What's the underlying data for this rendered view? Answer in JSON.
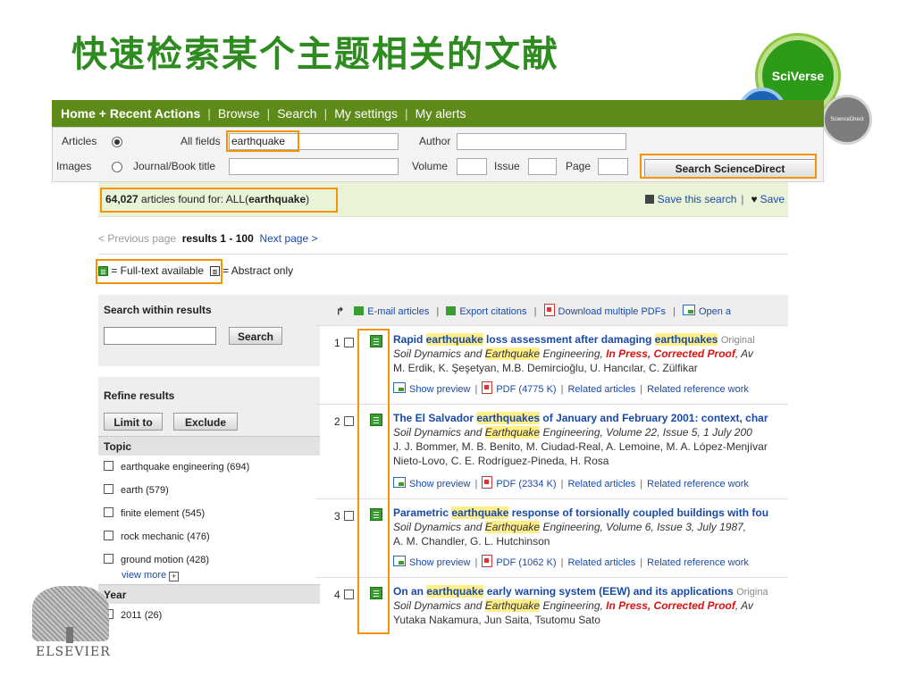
{
  "slide": {
    "title": "快速检索某个主题相关的文献"
  },
  "logos": {
    "sciverse": "SciVerse",
    "sciencedirect": "ScienceDirect",
    "publisher": "ELSEVIER"
  },
  "nav": {
    "home": "Home + Recent Actions",
    "items": [
      "Browse",
      "Search",
      "My settings",
      "My alerts"
    ]
  },
  "form": {
    "articles_label": "Articles",
    "images_label": "Images",
    "allfields_label": "All fields",
    "allfields_value": "earthquake",
    "journal_label": "Journal/Book title",
    "author_label": "Author",
    "volume_label": "Volume",
    "issue_label": "Issue",
    "page_label": "Page",
    "submit": "Search ScienceDirect"
  },
  "results_bar": {
    "count": "64,027",
    "found_text": " articles found for: ALL(",
    "query": "earthquake",
    "close": ")",
    "save_search": "Save this search",
    "save_more": "Save"
  },
  "pager": {
    "prev": "< Previous page",
    "current": "results 1 - 100",
    "next": "Next page >"
  },
  "legend": {
    "fulltext": "= Full-text available",
    "abstract": "= Abstract only"
  },
  "sidebar": {
    "search_within": "Search within results",
    "search_button": "Search",
    "refine": "Refine results",
    "limit": "Limit to",
    "exclude": "Exclude",
    "topic_head": "Topic",
    "topics": [
      "earthquake engineering (694)",
      "earth (579)",
      "finite element (545)",
      "rock mechanic (476)",
      "ground motion (428)"
    ],
    "view_more": "view more",
    "year_head": "Year",
    "years": [
      "2011 (26)"
    ]
  },
  "toolbar": {
    "email": "E-mail articles",
    "export": "Export citations",
    "download": "Download multiple PDFs",
    "open": "Open a"
  },
  "results": [
    {
      "num": "1",
      "title_parts": [
        "Rapid ",
        "earthquake",
        " loss assessment after damaging ",
        "earthquakes"
      ],
      "tag": "Original",
      "src_parts": [
        "Soil Dynamics and ",
        "Earthquake",
        " Engineering, "
      ],
      "src_press": "In Press, Corrected Proof",
      "src_tail": ", Av",
      "authors": [
        "M. Erdik, K. Şeşetyan, M.B. Demircioğlu, U. Hancılar, C. Zülfikar"
      ],
      "preview": "Show preview",
      "pdf": "PDF (4775 K)",
      "related": "Related articles",
      "related_ref": "Related reference work"
    },
    {
      "num": "2",
      "title_parts": [
        "The El Salvador ",
        "earthquakes",
        " of January and February 2001: context, char"
      ],
      "tag": "",
      "src_parts": [
        "Soil Dynamics and ",
        "Earthquake",
        " Engineering, Volume 22, Issue 5, 1 July 200"
      ],
      "src_press": "",
      "src_tail": "",
      "authors": [
        "J. J. Bommer, M. B. Benito, M. Ciudad-Real, A. Lemoine, M. A. López-Menjívar",
        "Nieto-Lovo, C. E. Rodríguez-Pineda, H. Rosa"
      ],
      "preview": "Show preview",
      "pdf": "PDF (2334 K)",
      "related": "Related articles",
      "related_ref": "Related reference work"
    },
    {
      "num": "3",
      "title_parts": [
        "Parametric ",
        "earthquake",
        " response of torsionally coupled buildings with fou",
        ""
      ],
      "tag": "",
      "src_parts": [
        "Soil Dynamics and ",
        "Earthquake",
        " Engineering, Volume 6, Issue 3, July 1987,"
      ],
      "src_press": "",
      "src_tail": "",
      "authors": [
        "A. M. Chandler, G. L. Hutchinson"
      ],
      "preview": "Show preview",
      "pdf": "PDF (1062 K)",
      "related": "Related articles",
      "related_ref": "Related reference work"
    },
    {
      "num": "4",
      "title_parts": [
        "On an ",
        "earthquake",
        " early warning system (EEW) and its applications",
        ""
      ],
      "tag": "Origina",
      "src_parts": [
        "Soil Dynamics and ",
        "Earthquake",
        " Engineering, "
      ],
      "src_press": "In Press, Corrected Proof",
      "src_tail": ", Av",
      "authors": [
        "Yutaka Nakamura, Jun Saita, Tsutomu Sato"
      ],
      "preview": "",
      "pdf": "",
      "related": "",
      "related_ref": ""
    }
  ],
  "colors": {
    "title_green": "#2e8b1f",
    "nav_green": "#5e8a1a",
    "highlight_orange": "#f39400",
    "link_blue": "#1a4aa8",
    "keyword_yellow": "#ffef8a"
  }
}
